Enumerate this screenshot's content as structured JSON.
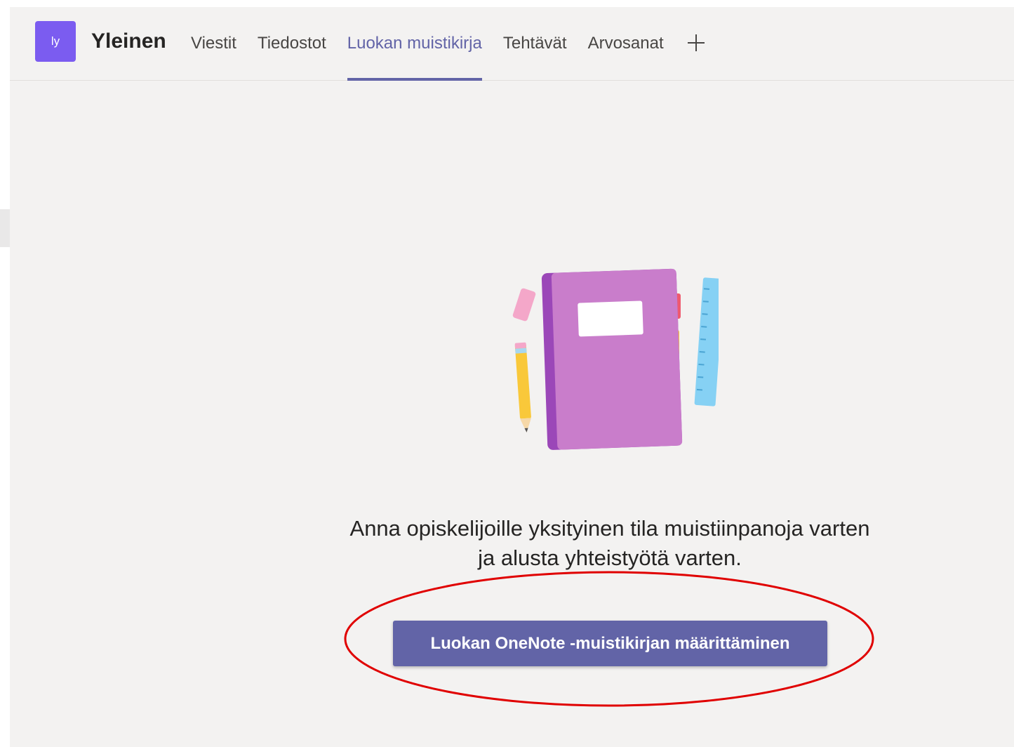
{
  "header": {
    "team_avatar_initials": "ly",
    "channel_name": "Yleinen",
    "tabs": [
      {
        "label": "Viestit",
        "active": false
      },
      {
        "label": "Tiedostot",
        "active": false
      },
      {
        "label": "Luokan muistikirja",
        "active": true
      },
      {
        "label": "Tehtävät",
        "active": false
      },
      {
        "label": "Arvosanat",
        "active": false
      }
    ],
    "add_tab_icon": "plus-icon"
  },
  "main": {
    "illustration_icon": "notebook-illustration",
    "message_line1": "Anna opiskelijoille yksityinen tila muistiinpanoja varten",
    "message_line2": "ja alusta yhteistyötä varten.",
    "setup_button_label": "Luokan OneNote -muistikirjan määrittäminen"
  },
  "colors": {
    "accent": "#6264a7",
    "avatar": "#7b5cf0",
    "background": "#f3f2f1",
    "annotation": "#e00000"
  }
}
